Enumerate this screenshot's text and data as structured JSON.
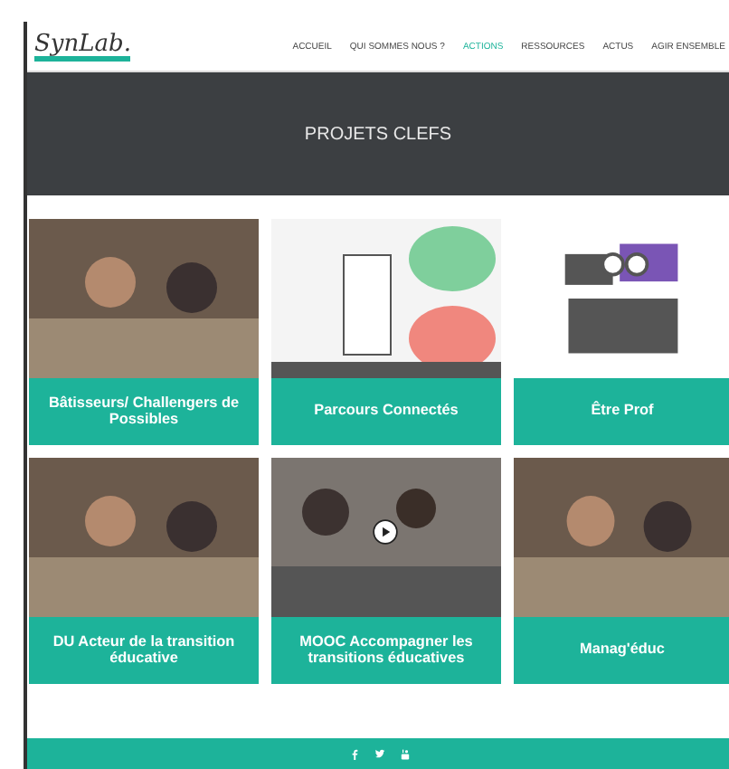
{
  "header": {
    "logo": "SynLab.",
    "nav": [
      {
        "label": "ACCUEIL",
        "selected": false
      },
      {
        "label": "QUI SOMMES NOUS ?",
        "selected": false
      },
      {
        "label": "ACTIONS",
        "selected": true
      },
      {
        "label": "RESSOURCES",
        "selected": false
      },
      {
        "label": "ACTUS",
        "selected": false
      },
      {
        "label": "AGIR ENSEMBLE",
        "selected": false
      }
    ]
  },
  "banner": {
    "title": "PROJETS CLEFS"
  },
  "projects": [
    {
      "title": "Bâtisseurs/ Challengers de Possibles",
      "kind": "photo"
    },
    {
      "title": "Parcours Connectés",
      "kind": "illustration"
    },
    {
      "title": "Être Prof",
      "kind": "logo"
    },
    {
      "title": "DU Acteur de la transition éducative",
      "kind": "photo"
    },
    {
      "title": "MOOC Accompagner les transitions éducatives",
      "kind": "video"
    },
    {
      "title": "Manag'éduc",
      "kind": "photo"
    }
  ],
  "footer": {
    "social": [
      {
        "kind": "facebook"
      },
      {
        "kind": "twitter"
      },
      {
        "kind": "youtube"
      }
    ]
  }
}
